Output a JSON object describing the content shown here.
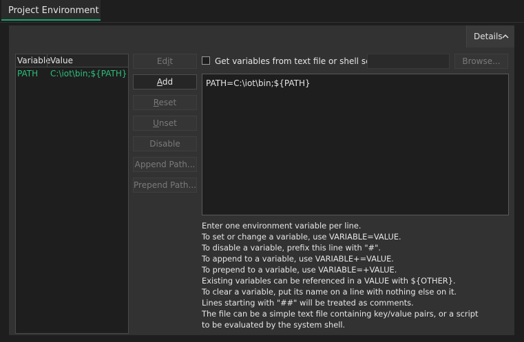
{
  "tab": {
    "label": "Project Environment"
  },
  "details": {
    "label": "Details"
  },
  "table": {
    "headers": [
      "Variable",
      "Value"
    ],
    "rows": [
      {
        "variable": "PATH",
        "value": "C:\\iot\\bin;${PATH}"
      }
    ]
  },
  "buttons": {
    "edit": {
      "pre": "Ed",
      "ul": "i",
      "post": "t"
    },
    "add": {
      "pre": "",
      "ul": "A",
      "post": "dd"
    },
    "reset": {
      "pre": "",
      "ul": "R",
      "post": "eset"
    },
    "unset": {
      "pre": "",
      "ul": "U",
      "post": "nset"
    },
    "disable": "Disable",
    "append_path": "Append Path...",
    "prepend_path": "Prepend Path..."
  },
  "file_option": {
    "checkbox_label": "Get variables from text file or shell script",
    "checked": false,
    "browse": "Browse..."
  },
  "editor": {
    "content": "PATH=C:\\iot\\bin;${PATH}"
  },
  "help_lines": [
    "Enter one environment variable per line.",
    "To set or change a variable, use VARIABLE=VALUE.",
    "To disable a variable, prefix this line with \"#\".",
    "To append to a variable, use VARIABLE+=VALUE.",
    "To prepend to a variable, use VARIABLE=+VALUE.",
    "Existing variables can be referenced in a VALUE with ${OTHER}.",
    "To clear a variable, put its name on a line with nothing else on it.",
    "Lines starting with \"##\" will be treated as comments.",
    "The file can be a simple text file containing key/value pairs, or a script",
    "to be evaluated by the system shell."
  ],
  "colors": {
    "accent": "#1aa772",
    "value_text": "#2bc07a"
  }
}
